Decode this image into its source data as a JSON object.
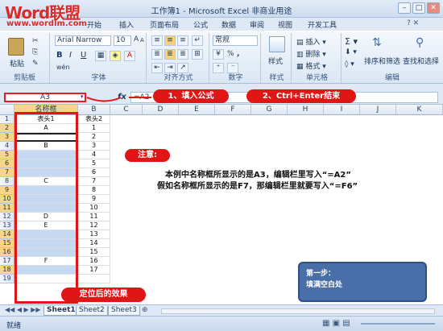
{
  "watermark": {
    "logo": "Word联盟",
    "url": "www.wordlm.com"
  },
  "window": {
    "title": "工作簿1 - Microsoft Excel 非商业用途",
    "controls": [
      "–",
      "□",
      "✕"
    ]
  },
  "tabs": [
    "开始",
    "插入",
    "页面布局",
    "公式",
    "数据",
    "审阅",
    "视图",
    "开发工具"
  ],
  "ribbon": {
    "clipboard": {
      "label": "剪贴板",
      "paste": "粘贴"
    },
    "font": {
      "label": "字体",
      "name": "Arial Narrow",
      "size": "10",
      "bold": "B",
      "italic": "I",
      "underline": "U",
      "grow": "A",
      "shrink": "A",
      "phonetic": "wén"
    },
    "alignment": {
      "label": "对齐方式"
    },
    "number": {
      "label": "数字",
      "format": "常规",
      "percent": "%",
      "comma": ","
    },
    "styles": {
      "label": "样式",
      "name": "样式"
    },
    "cells": {
      "label": "单元格",
      "insert": "插入",
      "delete": "删除",
      "format": "格式"
    },
    "editing": {
      "label": "编辑",
      "sort": "排序和筛选",
      "find": "查找和选择"
    }
  },
  "formula_bar": {
    "namebox": "A3",
    "fx": "fx",
    "formula": "=A2"
  },
  "callouts": {
    "step1": "1、填入公式",
    "step2": "2、Ctrl+Enter结束",
    "effect": "定位后的效果",
    "note_title": "注意:",
    "note_line1": "本例中名称框所显示的是A3，编辑栏里写入“=A2”",
    "note_line2": "假如名称框所显示的是F7，那编辑栏里就要写入“=F6”",
    "step_box_title": "第一步：",
    "step_box_text": "填满空白处"
  },
  "grid": {
    "columns": [
      "A",
      "B",
      "C",
      "D",
      "E",
      "F",
      "G",
      "H",
      "I",
      "J",
      "K"
    ],
    "a_label": "名称框",
    "header_row": {
      "a": "表头1",
      "b": "表头2"
    },
    "rows": [
      {
        "n": "2",
        "a": "A",
        "b": "1"
      },
      {
        "n": "3",
        "a": "",
        "b": "2"
      },
      {
        "n": "4",
        "a": "B",
        "b": "3"
      },
      {
        "n": "5",
        "a": "",
        "b": "4"
      },
      {
        "n": "6",
        "a": "",
        "b": "5"
      },
      {
        "n": "7",
        "a": "",
        "b": "6"
      },
      {
        "n": "8",
        "a": "C",
        "b": "7"
      },
      {
        "n": "9",
        "a": "",
        "b": "8"
      },
      {
        "n": "10",
        "a": "",
        "b": "9"
      },
      {
        "n": "11",
        "a": "",
        "b": "10"
      },
      {
        "n": "12",
        "a": "D",
        "b": "11"
      },
      {
        "n": "13",
        "a": "E",
        "b": "12"
      },
      {
        "n": "14",
        "a": "",
        "b": "13"
      },
      {
        "n": "15",
        "a": "",
        "b": "14"
      },
      {
        "n": "16",
        "a": "",
        "b": "15"
      },
      {
        "n": "17",
        "a": "F",
        "b": "16"
      },
      {
        "n": "18",
        "a": "",
        "b": "17"
      },
      {
        "n": "19",
        "a": "",
        "b": ""
      }
    ]
  },
  "sheets": [
    "Sheet1",
    "Sheet2",
    "Sheet3"
  ],
  "status": {
    "ready": "就绪"
  },
  "colors": {
    "accent_red": "#e01515",
    "selection_blue": "#c5daf2",
    "step_box": "#4a6fa8"
  }
}
